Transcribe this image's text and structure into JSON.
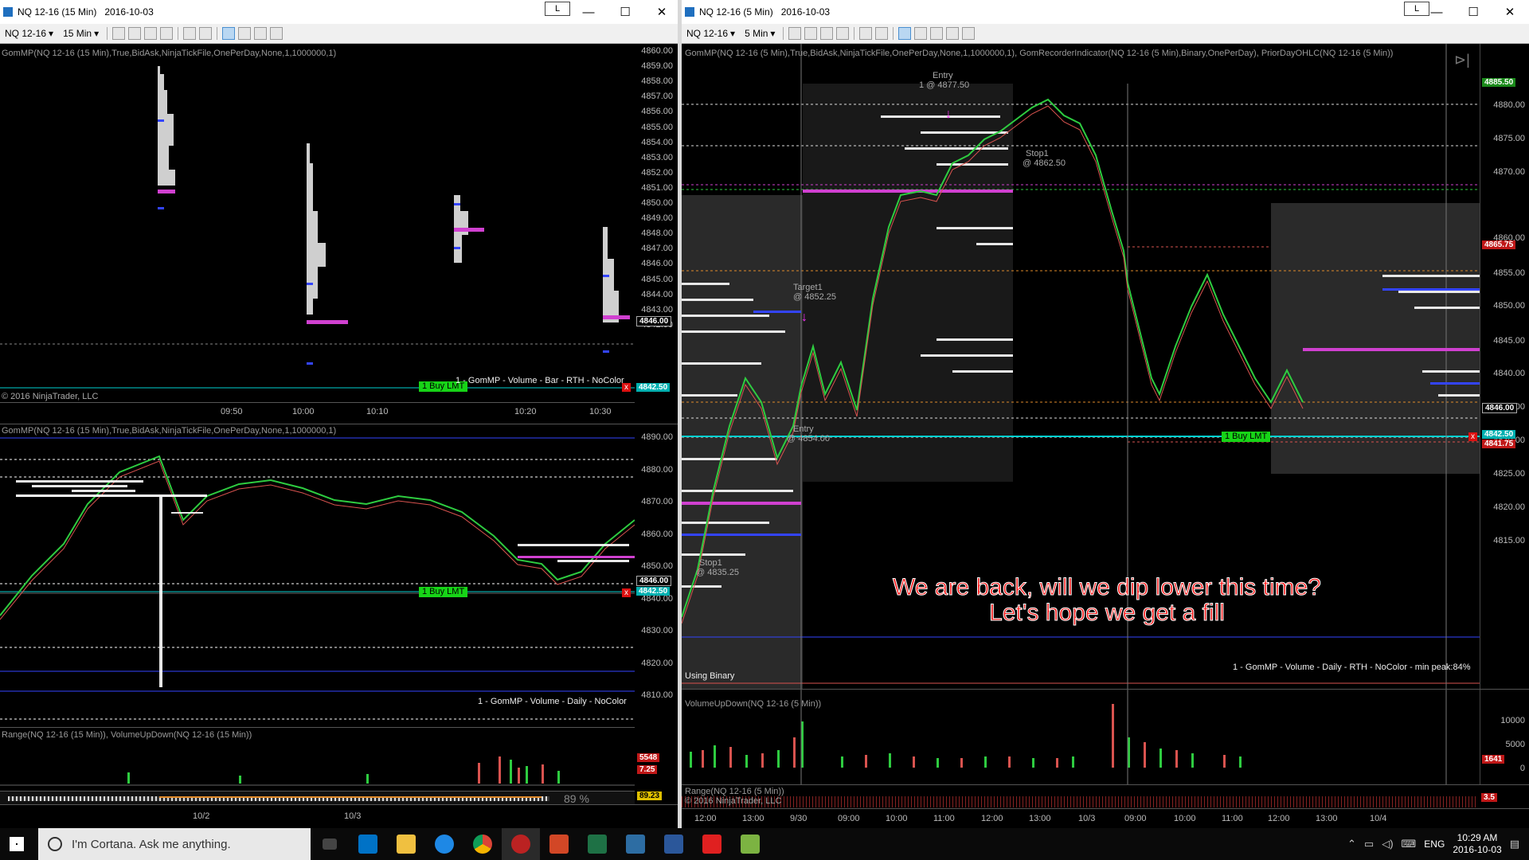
{
  "left_window": {
    "title_symbol": "NQ 12-16 (15 Min)",
    "title_date": "2016-10-03",
    "symbol": "NQ 12-16",
    "interval": "15 Min",
    "link_button": "L",
    "upper_chart": {
      "indicator_label": "GomMP(NQ 12-16 (15 Min),True,BidAsk,NinjaTickFile,OnePerDay,None,1,1000000,1)",
      "copyright": "© 2016 NinjaTrader, LLC",
      "profile_note": "1 - GomMP - Volume - Bar - RTH - NoColor",
      "price_ticks": [
        "4860.00",
        "4859.00",
        "4858.00",
        "4857.00",
        "4856.00",
        "4855.00",
        "4854.00",
        "4853.00",
        "4852.00",
        "4851.00",
        "4850.00",
        "4849.00",
        "4848.00",
        "4847.00",
        "4846.00",
        "4845.00",
        "4844.00",
        "4843.00",
        "4842.00"
      ],
      "last_price": "4846.00",
      "order_price": "4842.50",
      "time_labels": [
        "09:50",
        "10:00",
        "10:10",
        "10:20",
        "10:30"
      ],
      "order_label": "1  Buy LMT",
      "cancel_symbol": "x"
    },
    "lower_chart": {
      "indicator_label": "GomMP(NQ 12-16 (15 Min),True,BidAsk,NinjaTickFile,OnePerDay,None,1,1000000,1)",
      "profile_note": "1 - GomMP - Volume - Daily - NoColor",
      "price_ticks": [
        "4890.00",
        "4880.00",
        "4870.00",
        "4860.00",
        "4850.00",
        "4840.00",
        "4830.00",
        "4820.00",
        "4810.00"
      ],
      "last_price": "4846.00",
      "order_price": "4842.50",
      "order_label": "1  Buy LMT",
      "cancel_symbol": "x",
      "range_label": "Range(NQ 12-16 (15 Min)), VolumeUpDown(NQ 12-16 (15 Min))",
      "volume_tag": "5548",
      "range_tag": "7.25",
      "bottom_percent": "89 %",
      "bottom_tag": "89.23",
      "time_labels": [
        "10/2",
        "10/3"
      ]
    }
  },
  "right_window": {
    "title_symbol": "NQ 12-16 (5 Min)",
    "title_date": "2016-10-03",
    "symbol": "NQ 12-16",
    "interval": "5 Min",
    "link_button": "L",
    "indicator_label": "GomMP(NQ 12-16 (5 Min),True,BidAsk,NinjaTickFile,OnePerDay,None,1,1000000,1), GomRecorderIndicator(NQ 12-16 (5 Min),Binary,OnePerDay), PriorDayOHLC(NQ 12-16 (5 Min))",
    "price_ticks": [
      "4880.00",
      "4875.00",
      "4870.00",
      "4865.75",
      "4860.00",
      "4855.00",
      "4850.00",
      "4846.00",
      "4845.00",
      "4842.50",
      "4841.75",
      "4840.00",
      "4835.00",
      "4830.00",
      "4825.00",
      "4820.00",
      "4815.00"
    ],
    "tag_top": "4885.50",
    "tag_red": "4865.75",
    "tag_last": "4846.00",
    "tag_order": "4842.50",
    "tag_low": "4841.75",
    "entry_label": "Entry",
    "entry_price": "1 @ 4877.50",
    "stop_label": "Stop1",
    "stop_price": "@ 4862.50",
    "target_label": "Target1",
    "target_price": "@ 4852.25",
    "entry2_label": "Entry",
    "entry2_price": "@ 4854.00",
    "stop2_label": "Stop1",
    "stop2_price": "@ 4835.25",
    "order_label": "1  Buy LMT",
    "cancel_symbol": "x",
    "using_binary": "Using Binary",
    "profile_note": "1 - GomMP - Volume - Daily - RTH - NoColor - min peak:84%",
    "volume_label": "VolumeUpDown(NQ 12-16 (5 Min))",
    "volume_ticks": [
      "10000",
      "5000",
      "0"
    ],
    "volume_tag": "1641",
    "range_label": "Range(NQ 12-16 (5 Min))",
    "range_tag": "3.5",
    "copyright": "© 2016 NinjaTrader, LLC",
    "time_labels": [
      "12:00",
      "13:00",
      "9/30",
      "09:00",
      "10:00",
      "11:00",
      "12:00",
      "13:00",
      "10/3",
      "09:00",
      "10:00",
      "11:00",
      "12:00",
      "13:00",
      "10/4"
    ]
  },
  "annotation": {
    "line1": "We are back, will we dip lower this time?",
    "line2": "Let's hope we get a fill"
  },
  "taskbar": {
    "cortana_placeholder": "I'm Cortana. Ask me anything.",
    "apps": [
      "task-view",
      "outlook",
      "file-explorer",
      "edge",
      "chrome",
      "ninjatrader",
      "powerpoint",
      "excel",
      "tws",
      "word",
      "acrobat",
      "greenshot"
    ],
    "language": "ENG",
    "time": "10:29 AM",
    "date": "2016-10-03"
  },
  "colors": {
    "up_candle": "#2ecc40",
    "down_candle": "#d9534f",
    "profile": "#ffffff",
    "poc": "#d040d0",
    "value_line": "#3344ff",
    "order_line": "#00d0d0",
    "buy_tag": "#17d417",
    "annotation_text": "#ff1a1a"
  }
}
